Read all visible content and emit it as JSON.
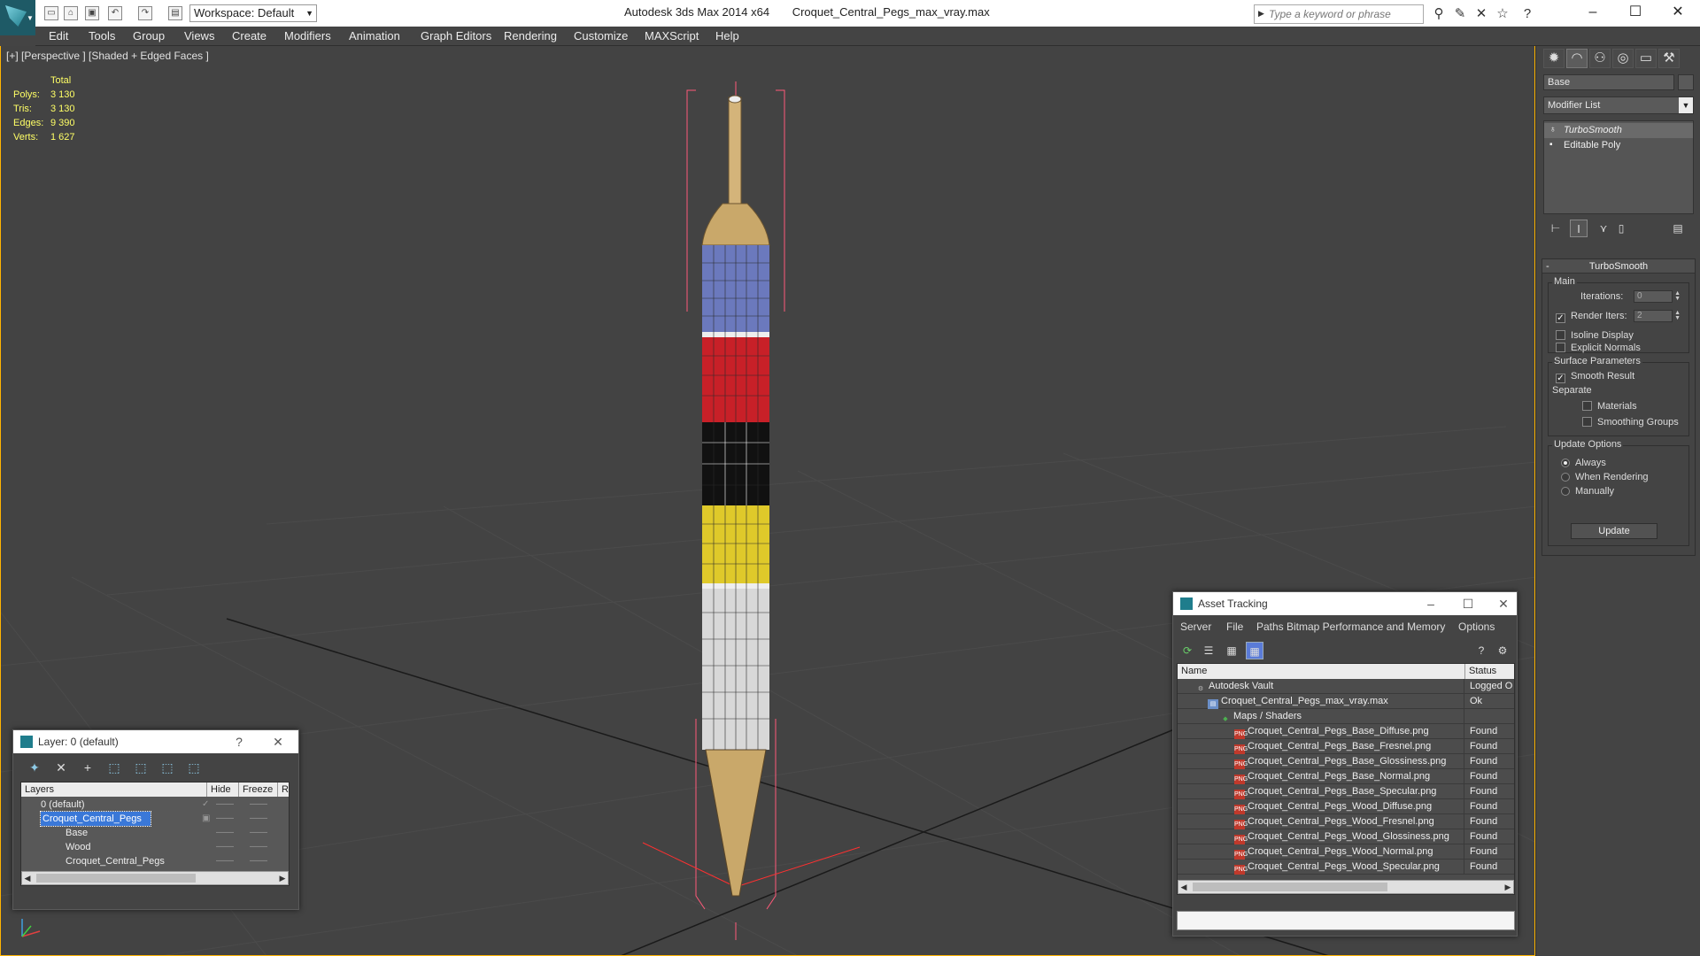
{
  "titlebar": {
    "app_title": "Autodesk 3ds Max  2014 x64",
    "file_name": "Croquet_Central_Pegs_max_vray.max",
    "workspace": "Workspace: Default",
    "search_placeholder": "Type a keyword or phrase",
    "minimize": "–",
    "maximize": "☐",
    "close": "✕"
  },
  "menu": [
    "Edit",
    "Tools",
    "Group",
    "Views",
    "Create",
    "Modifiers",
    "Animation",
    "Graph Editors",
    "Rendering",
    "Customize",
    "MAXScript",
    "Help"
  ],
  "viewport": {
    "label": "[+] [Perspective ] [Shaded + Edged Faces ]",
    "stats": {
      "header": "Total",
      "rows": [
        {
          "label": "Polys:",
          "value": "3 130"
        },
        {
          "label": "Tris:",
          "value": "3 130"
        },
        {
          "label": "Edges:",
          "value": "9 390"
        },
        {
          "label": "Verts:",
          "value": "1 627"
        }
      ]
    },
    "colors": {
      "blue": "#6b79bd",
      "red": "#c82028",
      "black": "#111111",
      "yellow": "#dfc92a",
      "white": "#d8d8d8",
      "wood": "#c9a86a",
      "selection": "#ff5a7a"
    }
  },
  "command_panel": {
    "object_name": "Base",
    "modifier_list": "Modifier List",
    "stack": [
      {
        "label": "TurboSmooth",
        "selected": true
      },
      {
        "label": "Editable Poly",
        "selected": false
      }
    ],
    "rollout_title": "TurboSmooth",
    "main_group": "Main",
    "iterations_label": "Iterations:",
    "iterations_value": "0",
    "render_iters_label": "Render Iters:",
    "render_iters_value": "2",
    "isoline_label": "Isoline Display",
    "explicit_normals_label": "Explicit Normals",
    "surface_group": "Surface Parameters",
    "smooth_result_label": "Smooth Result",
    "separate_label": "Separate",
    "materials_label": "Materials",
    "smoothing_groups_label": "Smoothing Groups",
    "update_group": "Update Options",
    "always_label": "Always",
    "when_rendering_label": "When Rendering",
    "manually_label": "Manually",
    "update_button": "Update"
  },
  "layer_dialog": {
    "title": "Layer: 0 (default)",
    "help": "?",
    "close": "✕",
    "columns": [
      "Layers",
      "Hide",
      "Freeze",
      "R"
    ],
    "rows": [
      {
        "name": "0 (default)",
        "hide": "——",
        "freeze": "——"
      },
      {
        "name": "Croquet_Central_Pegs",
        "hide": "——",
        "freeze": "——"
      },
      {
        "name": "Base",
        "hide": "——",
        "freeze": "——"
      },
      {
        "name": "Wood",
        "hide": "——",
        "freeze": "——"
      },
      {
        "name": "Croquet_Central_Pegs",
        "hide": "——",
        "freeze": "——"
      }
    ]
  },
  "asset_tracking": {
    "title": "Asset Tracking",
    "menu": [
      "Server",
      "File",
      "Paths",
      "Bitmap Performance and Memory",
      "Options"
    ],
    "columns": [
      "Name",
      "Status"
    ],
    "rows": [
      {
        "name": "Autodesk Vault",
        "status": "Logged O"
      },
      {
        "name": "Croquet_Central_Pegs_max_vray.max",
        "status": "Ok"
      },
      {
        "name": "Maps / Shaders",
        "status": ""
      },
      {
        "name": "Croquet_Central_Pegs_Base_Diffuse.png",
        "status": "Found"
      },
      {
        "name": "Croquet_Central_Pegs_Base_Fresnel.png",
        "status": "Found"
      },
      {
        "name": "Croquet_Central_Pegs_Base_Glossiness.png",
        "status": "Found"
      },
      {
        "name": "Croquet_Central_Pegs_Base_Normal.png",
        "status": "Found"
      },
      {
        "name": "Croquet_Central_Pegs_Base_Specular.png",
        "status": "Found"
      },
      {
        "name": "Croquet_Central_Pegs_Wood_Diffuse.png",
        "status": "Found"
      },
      {
        "name": "Croquet_Central_Pegs_Wood_Fresnel.png",
        "status": "Found"
      },
      {
        "name": "Croquet_Central_Pegs_Wood_Glossiness.png",
        "status": "Found"
      },
      {
        "name": "Croquet_Central_Pegs_Wood_Normal.png",
        "status": "Found"
      },
      {
        "name": "Croquet_Central_Pegs_Wood_Specular.png",
        "status": "Found"
      }
    ]
  }
}
